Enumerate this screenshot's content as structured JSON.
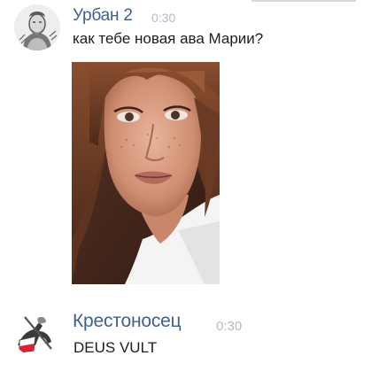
{
  "messages": [
    {
      "author": "Урбан 2",
      "time": "0:30",
      "text": "как тебе новая ава Марии?",
      "avatar_icon": "pope-portrait-avatar-icon",
      "attachment": "photo"
    },
    {
      "author": "Крестоносец",
      "time": "0:30",
      "text": "DEUS VULT",
      "avatar_icon": "crusader-knight-avatar-icon"
    }
  ],
  "colors": {
    "author_name": "#3f5f8f",
    "timestamp": "#b3bac4",
    "message_text": "#1d1d1d",
    "background": "#ffffff"
  }
}
